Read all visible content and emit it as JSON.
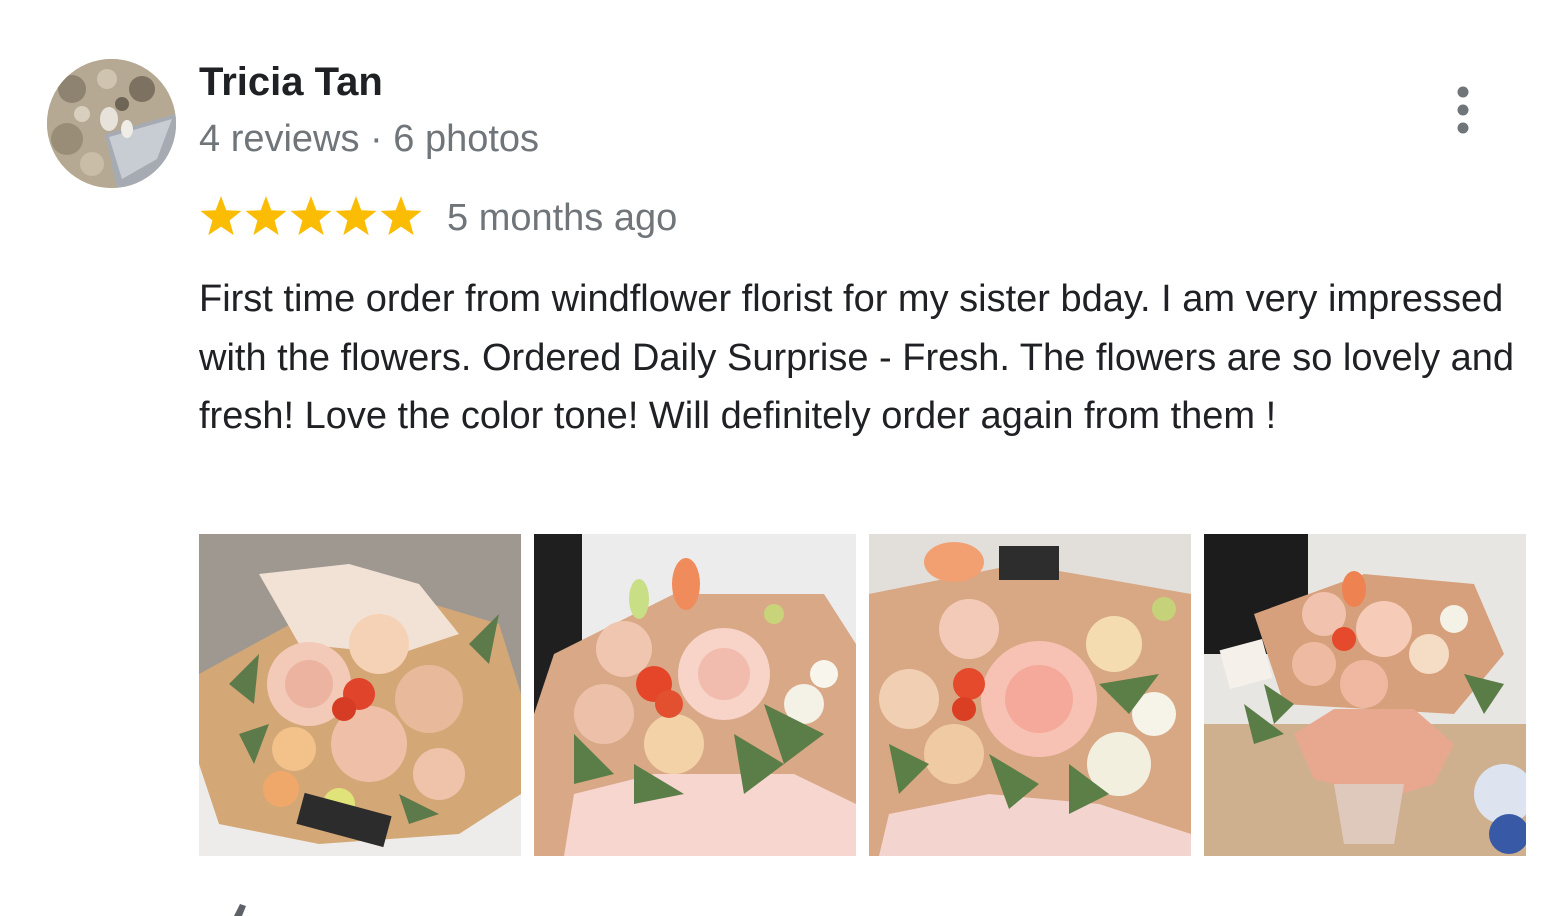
{
  "review": {
    "reviewer_name": "Tricia Tan",
    "reviewer_stats": "4 reviews · 6 photos",
    "rating": 5,
    "rating_max": 5,
    "time_ago": "5 months ago",
    "text": "First time order from windflower florist for my sister bday. I am very impressed with the flowers. Ordered Daily Surprise - Fresh. The flowers are so lovely and fresh! Love the color tone! Will definitely order again from them !",
    "photo_count_shown": 4
  },
  "icons": {
    "more": "more-vertical-icon",
    "star": "star-icon",
    "action": "thumbs-up-icon"
  },
  "colors": {
    "star": "#fbbc04",
    "secondary_text": "#70757a",
    "primary_text": "#202124",
    "more_icon": "#70757a"
  }
}
